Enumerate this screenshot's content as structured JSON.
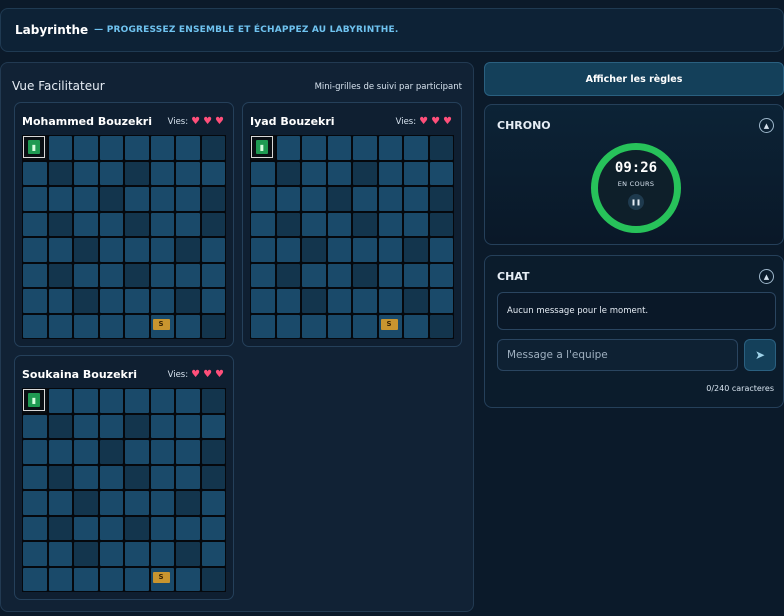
{
  "header": {
    "brand": "Labyrinthe",
    "tagline": "— PROGRESSEZ ENSEMBLE ET ÉCHAPPEZ AU LABYRINTHE."
  },
  "facilitator": {
    "title": "Vue Facilitateur",
    "subtitle": "Mini-grilles de suivi par participant",
    "lives_label": "Vies:",
    "participants": [
      {
        "name": "Mohammed Bouzekri",
        "lives": 3
      },
      {
        "name": "Iyad Bouzekri",
        "lives": 3
      },
      {
        "name": "Soukaina Bouzekri",
        "lives": 3
      }
    ],
    "exit_label": "S",
    "start_icon": "door-icon"
  },
  "rules_button": "Afficher les règles",
  "chrono": {
    "title": "CHRONO",
    "time": "09:26",
    "state": "EN COURS",
    "pause_icon": "pause-icon",
    "ring_color": "#27c25a"
  },
  "chat": {
    "title": "CHAT",
    "empty_message": "Aucun message pour le moment.",
    "input_placeholder": "Message a l'equipe",
    "input_value": "",
    "counter": "0/240 caracteres",
    "send_icon": "send-icon"
  }
}
